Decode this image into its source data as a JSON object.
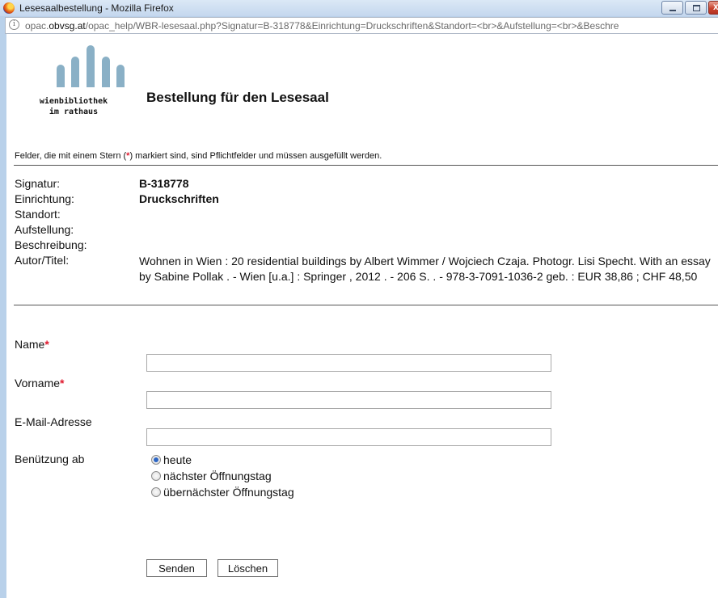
{
  "window": {
    "title": "Lesesaalbestellung - Mozilla Firefox",
    "url_prefix": "opac.",
    "url_domain": "obvsg.at",
    "url_rest": "/opac_help/WBR-lesesaal.php?Signatur=B-318778&Einrichtung=Druckschriften&Standort=<br>&Aufstellung=<br>&Beschre"
  },
  "logo": {
    "line1": "wienbibliothek",
    "line2": "im rathaus",
    "color": "#8ab0c6"
  },
  "page": {
    "title": "Bestellung für den Lesesaal",
    "hint_before": "Felder, die mit einem Stern (",
    "hint_star": "*",
    "hint_after": ") markiert sind, sind Pflichtfelder und müssen ausgefüllt werden."
  },
  "record": {
    "signatur_label": "Signatur:",
    "signatur_value": "B-318778",
    "einrichtung_label": "Einrichtung:",
    "einrichtung_value": "Druckschriften",
    "standort_label": "Standort:",
    "aufstellung_label": "Aufstellung:",
    "beschreibung_label": "Beschreibung:",
    "autor_label": "Autor/Titel:",
    "autor_value": "Wohnen in Wien : 20 residential buildings by Albert Wimmer / Wojciech Czaja. Photogr. Lisi Specht. With an essay by Sabine Pollak . - Wien [u.a.] : Springer , 2012 . - 206 S. . - 978-3-7091-1036-2 geb. : EUR 38,86 ; CHF 48,50"
  },
  "form": {
    "required_mark": "*",
    "name_label": "Name",
    "name_value": "",
    "vorname_label": "Vorname",
    "vorname_value": "",
    "email_label": "E-Mail-Adresse",
    "email_value": "",
    "benuetzung_label": "Benützung ab",
    "options": [
      "heute",
      "nächster Öffnungstag",
      "übernächster Öffnungstag"
    ],
    "selected_option": "heute",
    "submit_label": "Senden",
    "reset_label": "Löschen"
  },
  "colors": {
    "required": "#e0192e",
    "radio_selected": "#2b65c4"
  }
}
